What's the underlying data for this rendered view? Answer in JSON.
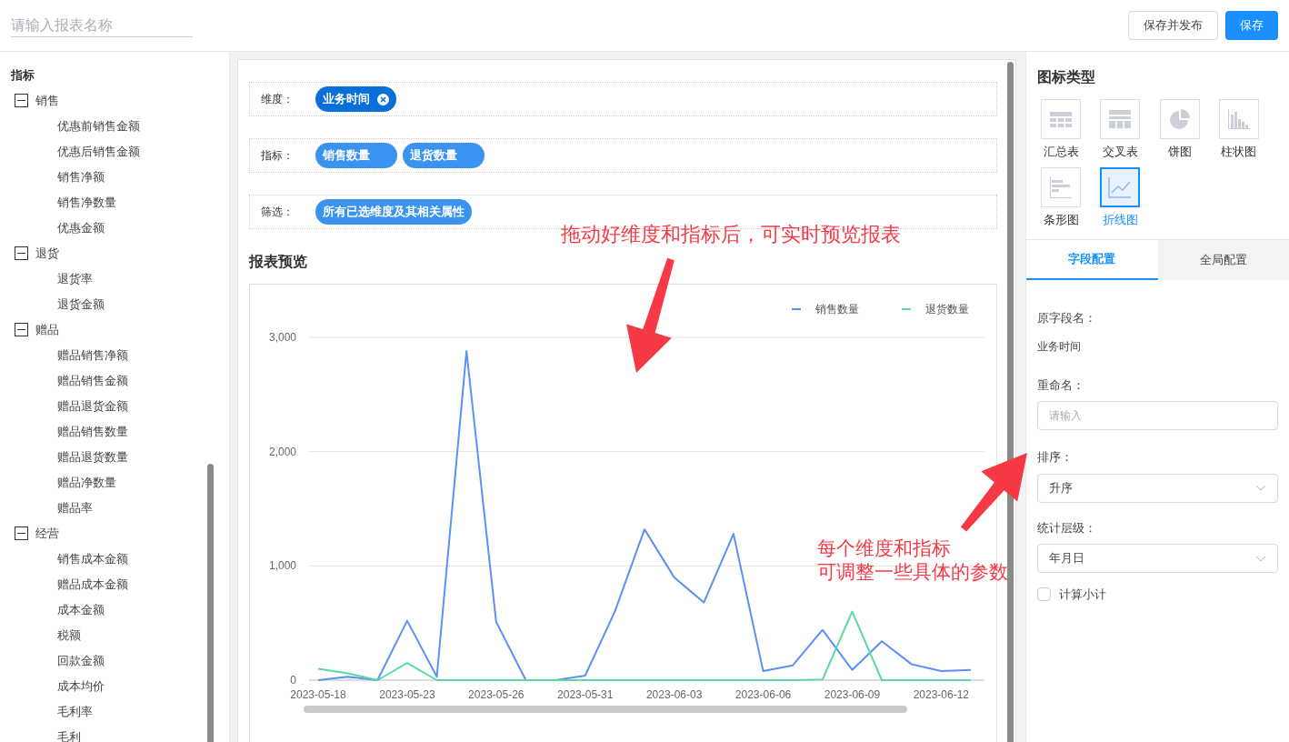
{
  "header": {
    "name_placeholder": "请输入报表名称",
    "buttons": [
      {
        "label": "保存并发布",
        "kind": "default"
      },
      {
        "label": "保存",
        "kind": "primary"
      }
    ]
  },
  "sidebar": {
    "title": "指标",
    "groups": [
      {
        "label": "销售",
        "expanded": true,
        "children": [
          {
            "label": "优惠前销售金额"
          },
          {
            "label": "优惠后销售金额"
          },
          {
            "label": "销售净额"
          },
          {
            "label": "销售净数量"
          },
          {
            "label": "优惠金额"
          }
        ]
      },
      {
        "label": "退货",
        "expanded": true,
        "children": [
          {
            "label": "退货率"
          },
          {
            "label": "退货金额"
          }
        ]
      },
      {
        "label": "赠品",
        "expanded": true,
        "children": [
          {
            "label": "赠品销售净额"
          },
          {
            "label": "赠品销售金额"
          },
          {
            "label": "赠品退货金额"
          },
          {
            "label": "赠品销售数量"
          },
          {
            "label": "赠品退货数量"
          },
          {
            "label": "赠品净数量"
          },
          {
            "label": "赠品率"
          }
        ]
      },
      {
        "label": "经营",
        "expanded": true,
        "children": [
          {
            "label": "销售成本金额"
          },
          {
            "label": "赠品成本金额"
          },
          {
            "label": "成本金额"
          },
          {
            "label": "税额"
          },
          {
            "label": "回款金额"
          },
          {
            "label": "成本均价"
          },
          {
            "label": "毛利率"
          },
          {
            "label": "毛利"
          }
        ]
      }
    ]
  },
  "drop_zones": [
    {
      "label": "维度：",
      "tags": [
        {
          "label": "业务时间",
          "kind": "dimension"
        }
      ]
    },
    {
      "label": "指标：",
      "tags": [
        {
          "label": "销售数量",
          "kind": "metric"
        },
        {
          "label": "退货数量",
          "kind": "metric"
        }
      ]
    },
    {
      "label": "筛选：",
      "tags": [
        {
          "label": "所有已选维度及其相关属性",
          "kind": "metric"
        }
      ]
    }
  ],
  "preview": {
    "title": "报表预览",
    "chart_data": {
      "type": "line",
      "categories": [
        "2023-05-18",
        null,
        null,
        "2023-05-23",
        null,
        null,
        "2023-05-26",
        null,
        null,
        "2023-05-31",
        null,
        null,
        "2023-06-03",
        null,
        null,
        "2023-06-06",
        null,
        null,
        "2023-06-09",
        null,
        null,
        "2023-06-12",
        null
      ],
      "series": [
        {
          "name": "销售数量",
          "color": "#5b8ff9",
          "values": [
            0,
            30,
            0,
            520,
            30,
            2880,
            510,
            0,
            0,
            40,
            600,
            1320,
            900,
            680,
            1280,
            80,
            130,
            440,
            90,
            340,
            140,
            80,
            90
          ]
        },
        {
          "name": "退货数量",
          "color": "#5ad8a6",
          "values": [
            100,
            60,
            0,
            150,
            0,
            0,
            0,
            0,
            0,
            0,
            0,
            0,
            0,
            0,
            0,
            0,
            0,
            5,
            600,
            0,
            0,
            0,
            0
          ]
        }
      ],
      "legend": "top-right",
      "ylim": [
        0,
        3000
      ],
      "yticks": [
        {
          "value": 0,
          "label": "0"
        },
        {
          "value": 1000,
          "label": "1,000"
        },
        {
          "value": 2000,
          "label": "2,000"
        },
        {
          "value": 3000,
          "label": "3,000"
        }
      ]
    }
  },
  "right_panel": {
    "title": "图标类型",
    "chart_types": [
      {
        "label": "汇总表",
        "kind": "table",
        "selected": false
      },
      {
        "label": "交叉表",
        "kind": "crosstab",
        "selected": false
      },
      {
        "label": "饼图",
        "kind": "pie",
        "selected": false
      },
      {
        "label": "柱状图",
        "kind": "bar",
        "selected": false
      },
      {
        "label": "条形图",
        "kind": "hbar",
        "selected": false
      },
      {
        "label": "折线图",
        "kind": "line",
        "selected": true
      }
    ],
    "tabs": [
      {
        "label": "字段配置",
        "selected": true
      },
      {
        "label": "全局配置",
        "selected": false
      }
    ],
    "original_field": {
      "label": "原字段名：",
      "value": "业务时间"
    },
    "rename": {
      "label": "重命名：",
      "placeholder": "请输入"
    },
    "sort": {
      "label": "排序：",
      "value": "升序"
    },
    "level": {
      "label": "统计层级：",
      "value": "年月日"
    },
    "subtotal": {
      "label": "计算小计",
      "checked": false
    }
  },
  "annotations": [
    {
      "lines": [
        "拖动好维度和指标后，可实时预览报表"
      ]
    },
    {
      "lines": [
        "每个维度和指标",
        "可调整一些具体的参数"
      ]
    }
  ]
}
